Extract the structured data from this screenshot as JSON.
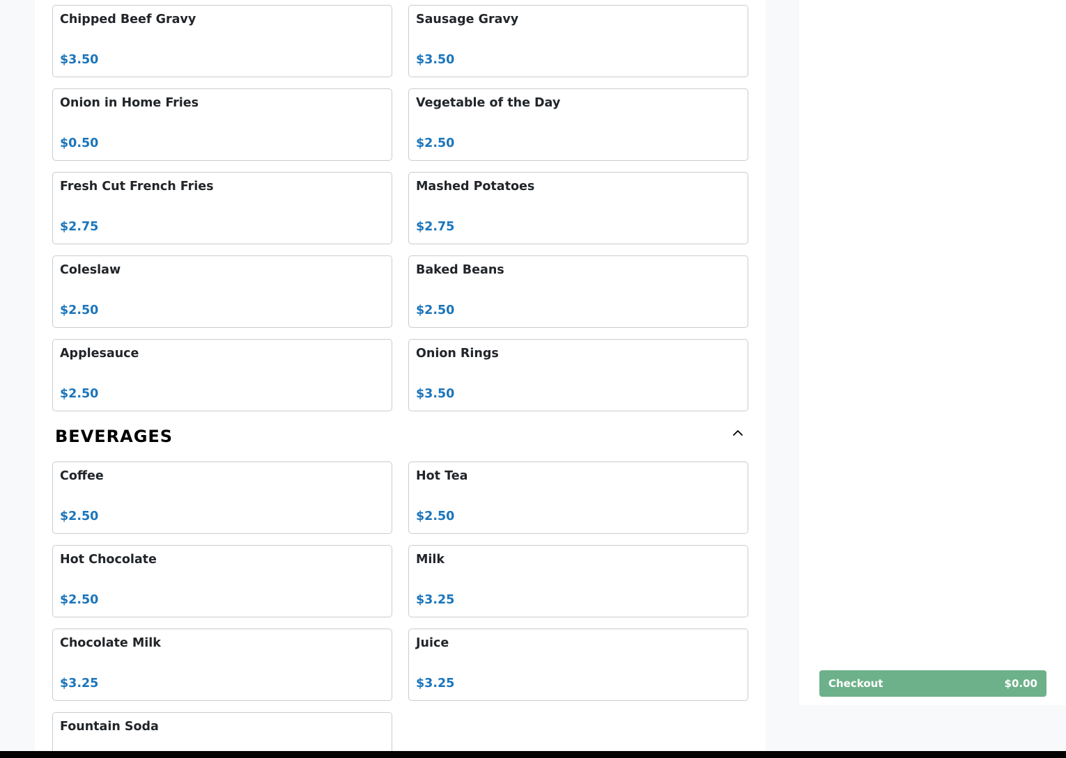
{
  "sides": {
    "items": [
      {
        "name": "Chipped Beef Gravy",
        "price": "$3.50"
      },
      {
        "name": "Sausage Gravy",
        "price": "$3.50"
      },
      {
        "name": "Onion in Home Fries",
        "price": "$0.50"
      },
      {
        "name": "Vegetable of the Day",
        "price": "$2.50"
      },
      {
        "name": "Fresh Cut French Fries",
        "price": "$2.75"
      },
      {
        "name": "Mashed Potatoes",
        "price": "$2.75"
      },
      {
        "name": "Coleslaw",
        "price": "$2.50"
      },
      {
        "name": "Baked Beans",
        "price": "$2.50"
      },
      {
        "name": "Applesauce",
        "price": "$2.50"
      },
      {
        "name": "Onion Rings",
        "price": "$3.50"
      }
    ]
  },
  "beverages": {
    "title": "BEVERAGES",
    "toggle_icon": "chevron-up-icon",
    "items": [
      {
        "name": "Coffee",
        "price": "$2.50"
      },
      {
        "name": "Hot Tea",
        "price": "$2.50"
      },
      {
        "name": "Hot Chocolate",
        "price": "$2.50"
      },
      {
        "name": "Milk",
        "price": "$3.25"
      },
      {
        "name": "Chocolate Milk",
        "price": "$3.25"
      },
      {
        "name": "Juice",
        "price": "$3.25"
      },
      {
        "name": "Fountain Soda",
        "price": ""
      }
    ]
  },
  "cart": {
    "checkout_label": "Checkout",
    "total": "$0.00"
  },
  "colors": {
    "price": "#1b75bb",
    "checkout": "#6db18a"
  }
}
